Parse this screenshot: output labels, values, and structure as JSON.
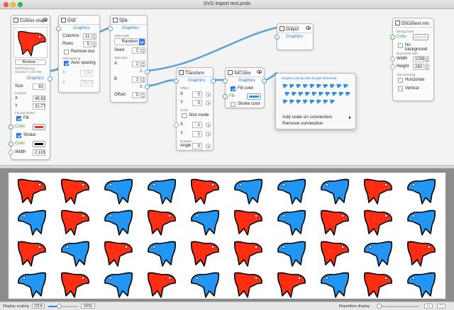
{
  "window": {
    "title": "SVG import test.pnds"
  },
  "colors": {
    "red_shape": "#ff2d12",
    "blue_shape": "#2196f3",
    "accent": "#2f7ef6",
    "wire": "#5b9fd8"
  },
  "nodes": {
    "custom_shape": {
      "type": "Element",
      "name": "Custom shape",
      "browse_label": "Browse...",
      "file_name": "RedThing.svg",
      "file_info": "181.514 × 124.769",
      "output_label": "Graphics",
      "size_label": "Size",
      "size_value": "81",
      "position_label": "Position",
      "x_label": "X",
      "x_value": "48.82",
      "y_label": "Y",
      "y_value": "31.77",
      "fill_stroke_label": "Fill and stroke",
      "fill_label": "Fill",
      "fill_checked": true,
      "color_label_1": "Color",
      "fill_color": "#ff2d12",
      "stroke_label": "Stroke",
      "stroke_checked": true,
      "color_label_2": "Color",
      "stroke_color": "#000000",
      "width_label": "Width",
      "width_value": "2.116"
    },
    "grid": {
      "type": "Repeat",
      "name": "Grid",
      "graphics_label": "Graphics",
      "columns_label": "Columns",
      "columns_value": "11",
      "rows_label": "Rows",
      "rows_value": "5",
      "remove_last_label": "Remove last",
      "remove_last_checked": false,
      "grid_spacing_label": "Grid spacing",
      "auto_spacing_label": "Auto spacing",
      "auto_spacing_checked": true,
      "x_label": "X",
      "x_value": "100",
      "y_label": "Y",
      "y_value": "75.77"
    },
    "split": {
      "type": "Filter",
      "name": "Split",
      "graphics_label": "Graphics",
      "mode_label": "Split mode",
      "mode_value": "Random",
      "seed_label": "Seed",
      "seed_value": "2",
      "ratio_label": "Split ratio",
      "a_label": "A",
      "a_value": "1",
      "b_label": "B",
      "b_value": "1",
      "offset_label": "Offset",
      "offset_value": "0",
      "out_a": "A",
      "out_b": "B"
    },
    "transform": {
      "type": "Filter",
      "name": "Transform",
      "graphics_label": "Graphics",
      "offset_label": "Offset",
      "x_label": "X",
      "x_value": "0",
      "y_label": "Y",
      "y_value": "0",
      "scale_label": "Scale",
      "size_mode_label": "Size mode",
      "size_mode_checked": false,
      "sx_label": "X",
      "sx_value": "-1",
      "sy_label": "Y",
      "sy_value": "1",
      "rotation_label": "Rotation",
      "angle_label": "Angle",
      "angle_value": "0"
    },
    "set_color": {
      "type": "Transform",
      "name": "Set color",
      "graphics_label": "Graphics",
      "fill_color_label": "Fill color",
      "fill_color_checked": true,
      "fill_label": "Fill",
      "fill_color": "#2196f3",
      "stroke_color_label": "Stroke color",
      "stroke_color_checked": false
    },
    "output": {
      "type": "Document",
      "name": "Output",
      "graphics_label": "Graphics"
    },
    "doc_info": {
      "type": "Document",
      "name": "Document info",
      "background_label": "Background",
      "color_label": "Color",
      "background_color": "#ffffff",
      "no_background_label": "No background",
      "no_background_checked": false,
      "size_label": "Document size",
      "width_label": "Width",
      "width_value": "1000",
      "height_label": "Height",
      "height_value": "283",
      "tile_label": "Tile mirroring",
      "horizontal_label": "Horizontal",
      "horizontal_checked": false,
      "vertical_label": "Vertical",
      "vertical_checked": false
    }
  },
  "popup": {
    "title": "Graphics (array with 28 path elements)",
    "items": [
      "Add node on connection",
      "Remove connection"
    ]
  },
  "preview": {
    "rows": [
      [
        "R",
        "R",
        "B",
        "B",
        "R",
        "B",
        "B",
        "B",
        "R",
        "B"
      ],
      [
        "B",
        "R",
        "B",
        "R",
        "B",
        "R",
        "B",
        "R",
        "R",
        "B"
      ],
      [
        "R",
        "B",
        "R",
        "B",
        "R",
        "R",
        "B",
        "R",
        "B",
        "R"
      ],
      [
        "B",
        "R",
        "B",
        "R",
        "B",
        "R",
        "R",
        "B",
        "R",
        "B"
      ]
    ]
  },
  "status": {
    "scaling_label": "Display scaling",
    "scaling_value": "131%",
    "zoom_reset_label": "100%",
    "repetition_label": "Repetition display"
  }
}
